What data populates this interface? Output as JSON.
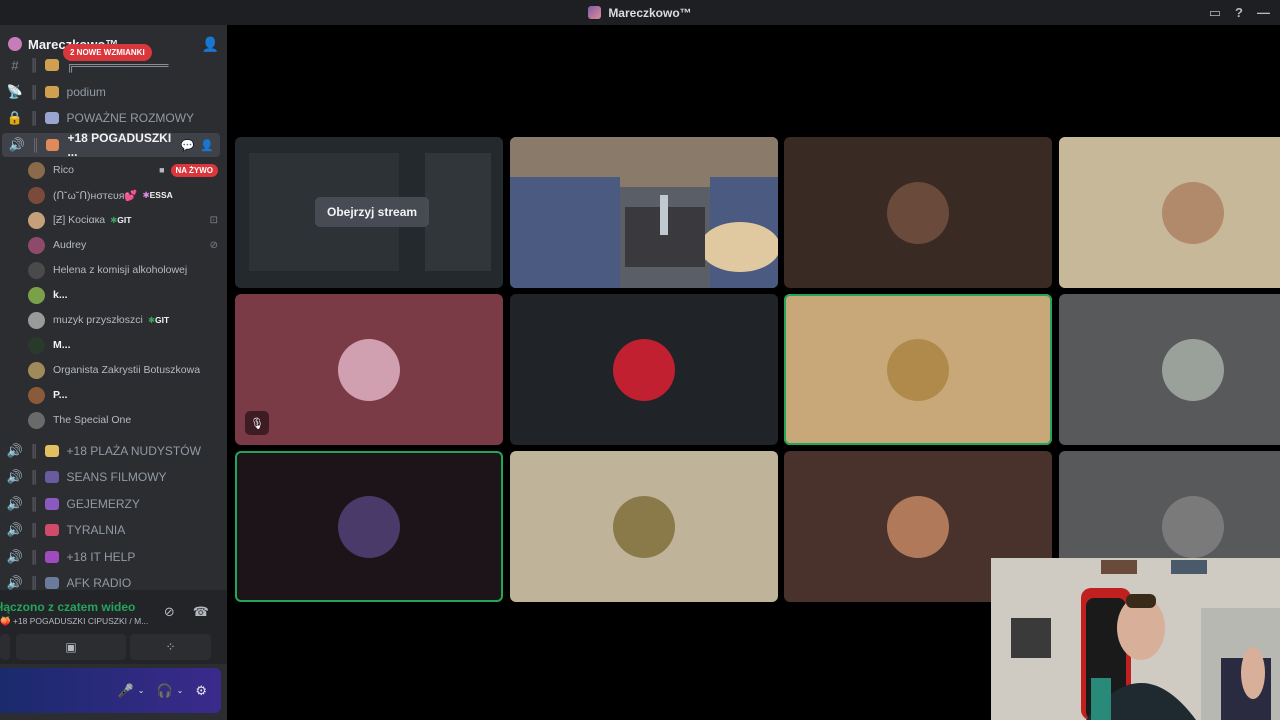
{
  "window": {
    "title": "Mareczkowo™",
    "right_icons": [
      "inbox-icon",
      "help-icon",
      "minimize-icon"
    ]
  },
  "server": {
    "name": "Mareczkowo™",
    "mention_pill": "2 NOWE WZMIANKI"
  },
  "channels_top": [
    {
      "icon": "hash-icon",
      "label": "╔═══════════"
    },
    {
      "icon": "stage-icon",
      "label": "podium"
    },
    {
      "icon": "lock-icon",
      "label": "POWAŻNE ROZMOWY"
    }
  ],
  "active_channel": {
    "label": "+18 POGADUSZKI ...",
    "icon": "speaker-icon"
  },
  "members": [
    {
      "name": "Rico",
      "tag": "",
      "live": "NA ŻYWO",
      "avatar_color": "#8a6a4a"
    },
    {
      "name": "(ᑎ˘ω˘ᑎ)нσтєυя💕",
      "tag": "ESSA",
      "avatar_color": "#7a4a3a"
    },
    {
      "name": "[Ƶ] Kociαкa",
      "tag": "GIT",
      "avatar_color": "#c5a07a"
    },
    {
      "name": "Audrey",
      "tag": "",
      "avatar_color": "#8e4a6a"
    },
    {
      "name": "Helena z komisji alkoholowej",
      "tag": "",
      "avatar_color": "#4a4a4a"
    },
    {
      "name": "k...",
      "tag": "",
      "avatar_color": "#7aa04a"
    },
    {
      "name": "muzyk przyszłoszci",
      "tag": "GIT",
      "avatar_color": "#9a9a9a"
    },
    {
      "name": "M...",
      "tag": "",
      "avatar_color": "#2a3a2a"
    },
    {
      "name": "Organista Zakrystii Botuszkowa",
      "tag": "",
      "avatar_color": "#a08a5a"
    },
    {
      "name": "P...",
      "tag": "",
      "avatar_color": "#8a5a3a"
    },
    {
      "name": "The Special One",
      "tag": "",
      "avatar_color": "#6a6a6a"
    }
  ],
  "channels_bottom": [
    {
      "label": "+18 PLAŻA NUDYSTÓW",
      "emo_color": "#e0c060"
    },
    {
      "label": "SEANS FILMOWY",
      "emo_color": "#6a5aa0"
    },
    {
      "label": "GEJEMERZY",
      "emo_color": "#8a5ac0"
    },
    {
      "label": "TYRALNIA",
      "emo_color": "#d04a6a"
    },
    {
      "label": "+18 IT HELP",
      "emo_color": "#a04ac0"
    },
    {
      "label": "AFK RADIO",
      "emo_color": "#6a7a9a"
    }
  ],
  "voice_panel": {
    "status": "łączono z czatem wideo",
    "channel": "+18 POGADUSZKI CIPUSZKI / M..."
  },
  "grid": {
    "watch_stream_label": "Obejrzyj stream",
    "tiles": [
      {
        "bg": "#22272a",
        "type": "stream"
      },
      {
        "bg": "#5a5e66",
        "type": "camera"
      },
      {
        "bg": "#3a2a24",
        "avatar": "#6a4a3a"
      },
      {
        "bg": "#c8b89a",
        "avatar": "#b08a6a"
      },
      {
        "bg": "#7a3a46",
        "avatar": "#d0a0b0",
        "muted": true
      },
      {
        "bg": "#202428",
        "avatar": "#c02030"
      },
      {
        "bg": "#c8a878",
        "avatar": "#b08a4a",
        "speaking": true
      },
      {
        "bg": "#58595a",
        "avatar": "#9aa09a"
      },
      {
        "bg": "#1c1418",
        "avatar": "#4a3a6a",
        "speaking": true
      },
      {
        "bg": "#bfb39a",
        "avatar": "#8a7a4a"
      },
      {
        "bg": "#4a322c",
        "avatar": "#b07a5a"
      },
      {
        "bg": "#58595a",
        "avatar": "#7a7a7a"
      }
    ]
  },
  "colors": {
    "live": "#da373c",
    "speaking": "#23a55a",
    "accent": "#5865f2"
  }
}
